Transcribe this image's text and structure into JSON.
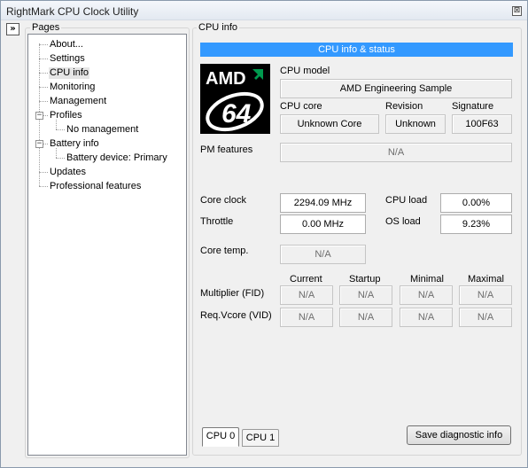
{
  "window": {
    "title": "RightMark CPU Clock Utility",
    "close_glyph": "⊠",
    "collapse_glyph": "»"
  },
  "pages": {
    "group_label": "Pages",
    "items": [
      {
        "label": "About...",
        "level": 0
      },
      {
        "label": "Settings",
        "level": 0
      },
      {
        "label": "CPU info",
        "level": 0,
        "selected": true
      },
      {
        "label": "Monitoring",
        "level": 0
      },
      {
        "label": "Management",
        "level": 0
      },
      {
        "label": "Profiles",
        "level": 0,
        "expanded": true
      },
      {
        "label": "No management",
        "level": 1
      },
      {
        "label": "Battery info",
        "level": 0,
        "expanded": true
      },
      {
        "label": "Battery device: Primary",
        "level": 1
      },
      {
        "label": "Updates",
        "level": 0
      },
      {
        "label": "Professional features",
        "level": 0
      }
    ],
    "expand_glyph": "−"
  },
  "cpu_info": {
    "group_label": "CPU info",
    "header": "CPU info & status",
    "logo_text": "AMD",
    "logo_number": "64",
    "model_label": "CPU model",
    "model_value": "AMD Engineering Sample",
    "core_label": "CPU core",
    "core_value": "Unknown Core",
    "revision_label": "Revision",
    "revision_value": "Unknown",
    "signature_label": "Signature",
    "signature_value": "100F63",
    "pm_label": "PM features",
    "pm_value": "N/A",
    "core_clock_label": "Core clock",
    "core_clock_value": "2294.09 MHz",
    "throttle_label": "Throttle",
    "throttle_value": "0.00 MHz",
    "cpu_load_label": "CPU load",
    "cpu_load_value": "0.00%",
    "os_load_label": "OS load",
    "os_load_value": "9.23%",
    "core_temp_label": "Core temp.",
    "core_temp_value": "N/A",
    "col_current": "Current",
    "col_startup": "Startup",
    "col_minimal": "Minimal",
    "col_maximal": "Maximal",
    "multiplier_label": "Multiplier (FID)",
    "multiplier_values": [
      "N/A",
      "N/A",
      "N/A",
      "N/A"
    ],
    "vcore_label": "Req.Vcore (VID)",
    "vcore_values": [
      "N/A",
      "N/A",
      "N/A",
      "N/A"
    ]
  },
  "footer": {
    "tabs": [
      {
        "label": "CPU 0",
        "active": true
      },
      {
        "label": "CPU 1",
        "active": false
      }
    ],
    "diagnostic_button": "Save diagnostic info"
  },
  "colors": {
    "header_bar": "#3399ff",
    "window_bg": "#f0f0f0",
    "logo_bg": "#000000",
    "logo_arrow": "#009a4e"
  }
}
